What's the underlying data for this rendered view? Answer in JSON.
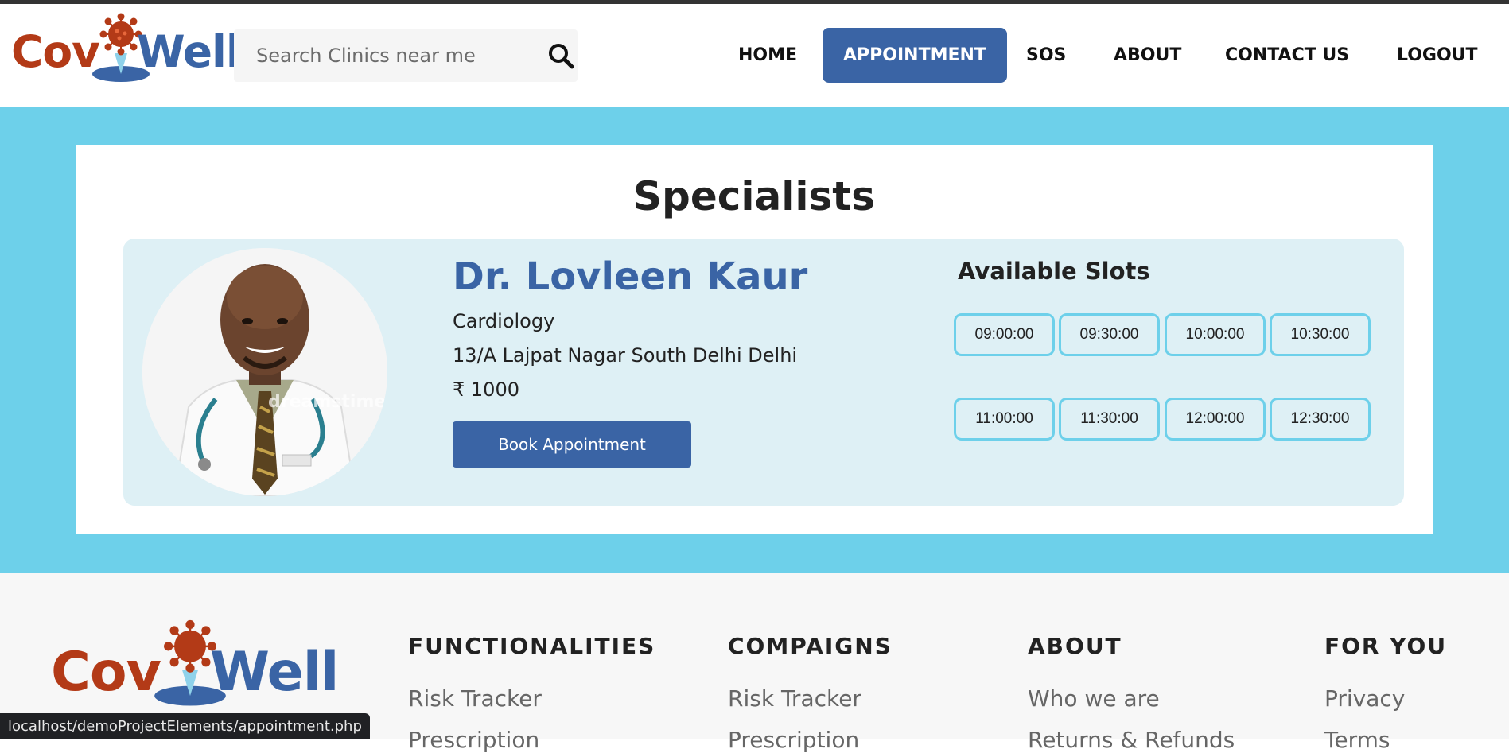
{
  "brand": {
    "part1": "Cov",
    "part2": "Well",
    "cov_color": "#b33a17",
    "well_color": "#3a64a5"
  },
  "search": {
    "placeholder": "Search Clinics near me",
    "value": "",
    "icon": "search-icon"
  },
  "nav": {
    "items": [
      {
        "label": "HOME",
        "active": false
      },
      {
        "label": "APPOINTMENT",
        "active": true
      },
      {
        "label": "SOS",
        "active": false
      },
      {
        "label": "ABOUT",
        "active": false
      },
      {
        "label": "CONTACT US",
        "active": false
      },
      {
        "label": "LOGOUT",
        "active": false
      }
    ],
    "active_color": "#3a64a5"
  },
  "main": {
    "title": "Specialists",
    "band_color": "#6dd0ea",
    "doctor": {
      "name": "Dr. Lovleen Kaur",
      "specialty": "Cardiology",
      "address": "13/A Lajpat Nagar South Delhi Delhi",
      "fee": "₹ 1000",
      "book_label": "Book Appointment",
      "watermark": "dreamstime."
    },
    "slots": {
      "title": "Available Slots",
      "times": [
        "09:00:00",
        "09:30:00",
        "10:00:00",
        "10:30:00",
        "11:00:00",
        "11:30:00",
        "12:00:00",
        "12:30:00"
      ]
    }
  },
  "footer": {
    "columns": [
      {
        "heading": "FUNCTIONALITIES",
        "links": [
          "Risk Tracker",
          "Prescription"
        ]
      },
      {
        "heading": "COMPAIGNS",
        "links": [
          "Risk Tracker",
          "Prescription"
        ]
      },
      {
        "heading": "ABOUT",
        "links": [
          "Who we are",
          "Returns & Refunds"
        ]
      },
      {
        "heading": "FOR YOU",
        "links": [
          "Privacy",
          "Terms"
        ]
      }
    ]
  },
  "status_bar": {
    "url": "localhost/demoProjectElements/appointment.php"
  }
}
